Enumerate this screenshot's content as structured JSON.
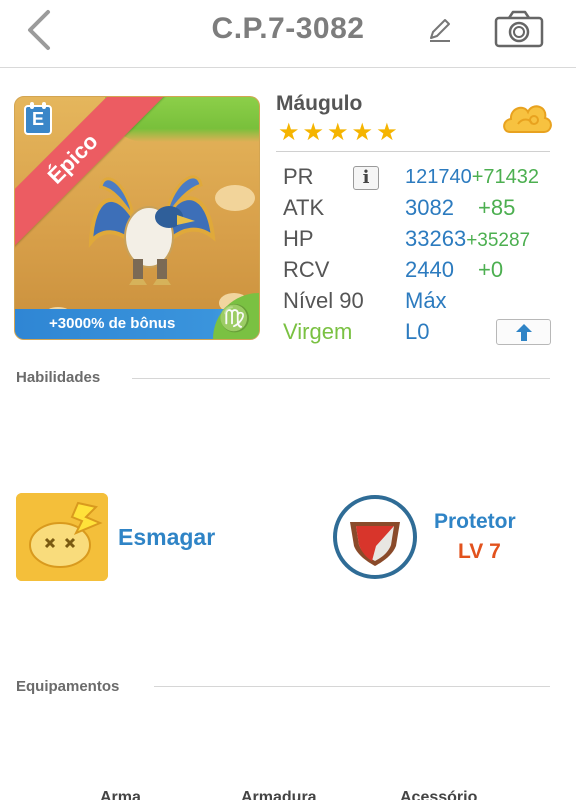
{
  "header": {
    "title": "C.P.7-3082"
  },
  "monster": {
    "name": "Máugulo",
    "rarity": "Épico",
    "rarity_color": "#ec5c62",
    "stars": 5,
    "bonus_text": "+3000% de bônus",
    "zodiac_symbol": "♍",
    "element_icon": "cloud-icon",
    "card_badge": "E"
  },
  "stats": {
    "pr": {
      "label": "PR",
      "value": "121740",
      "bonus": "+71432"
    },
    "atk": {
      "label": "ATK",
      "value": "3082",
      "bonus": "+85"
    },
    "hp": {
      "label": "HP",
      "value": "33263",
      "bonus": "+35287"
    },
    "rcv": {
      "label": "RCV",
      "value": "2440",
      "bonus": "+0"
    },
    "level": {
      "label": "Nível 90",
      "value": "Máx"
    },
    "sign": {
      "label": "Virgem",
      "value": "L0"
    },
    "info_button": "i"
  },
  "sections": {
    "skills_title": "Habilidades",
    "equipment_title": "Equipamentos"
  },
  "skills": {
    "active": {
      "name": "Esmagar",
      "icon": "smash-icon"
    },
    "passive": {
      "name": "Protetor",
      "level": "LV 7",
      "icon": "shield-icon"
    }
  },
  "equipment_tabs": [
    "Arma",
    "Armadura",
    "Acessório"
  ],
  "colors": {
    "accent_blue": "#2f84c6",
    "bonus_green": "#4caf50",
    "level_orange": "#e2521d",
    "star_gold": "#f5b400"
  }
}
